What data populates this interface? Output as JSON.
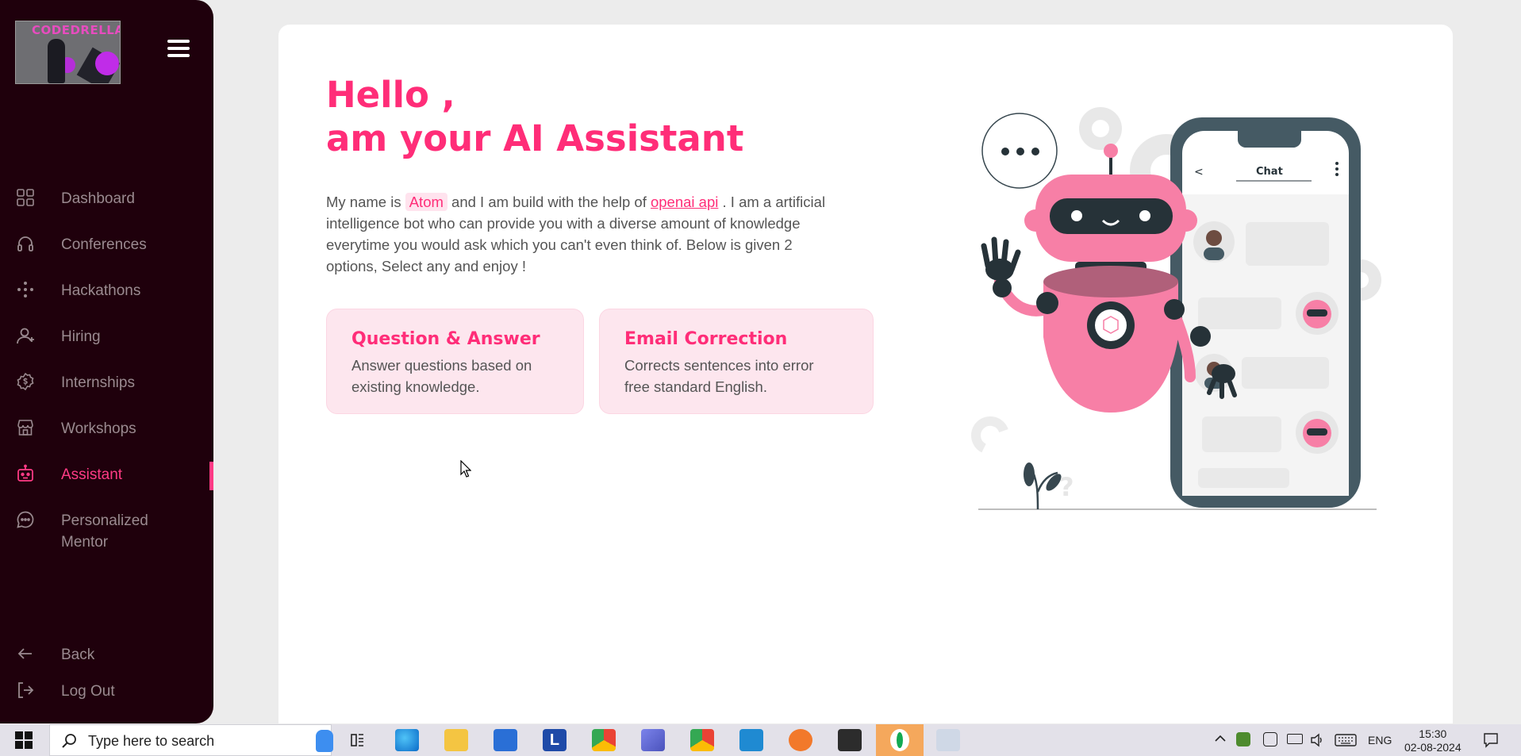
{
  "logo": {
    "text": "CODEDRELLA"
  },
  "sidebar": {
    "items": [
      {
        "label": "Dashboard",
        "icon": "grid-icon"
      },
      {
        "label": "Conferences",
        "icon": "headphones-icon"
      },
      {
        "label": "Hackathons",
        "icon": "dots-icon"
      },
      {
        "label": "Hiring",
        "icon": "user-plus-icon"
      },
      {
        "label": "Internships",
        "icon": "badge-dollar-icon"
      },
      {
        "label": "Workshops",
        "icon": "store-icon"
      },
      {
        "label": "Assistant",
        "icon": "robot-icon"
      },
      {
        "label": "Personalized Mentor",
        "icon": "chat-bubble-icon"
      }
    ],
    "back_label": "Back",
    "logout_label": "Log Out"
  },
  "main": {
    "greeting_line1": "Hello ,",
    "greeting_line2": "am your AI Assistant",
    "desc_prefix": "My name is",
    "bot_name": "Atom",
    "desc_middle": "and I am build with the help of",
    "api_link": "openai api",
    "desc_suffix": ". I am a artificial intelligence bot who can provide you with a diverse amount of knowledge everytime you would ask which you can't even think of. Below is given 2 options, Select any and enjoy !",
    "options": [
      {
        "title": "Question & Answer",
        "subtitle_line1": "Answer questions based on",
        "subtitle_line2": "existing knowledge."
      },
      {
        "title": "Email Correction",
        "subtitle_line1": "Corrects sentences into error",
        "subtitle_line2": "free standard English."
      }
    ],
    "illustration": {
      "chat_header": "Chat",
      "back_glyph": "<"
    }
  },
  "taskbar": {
    "search_placeholder": "Type here to search",
    "language": "ENG",
    "time": "15:30",
    "date": "02-08-2024"
  },
  "colors": {
    "accent": "#ff2d78",
    "sidebar_bg": "#1f000c",
    "card_bg": "#fde6ee"
  }
}
